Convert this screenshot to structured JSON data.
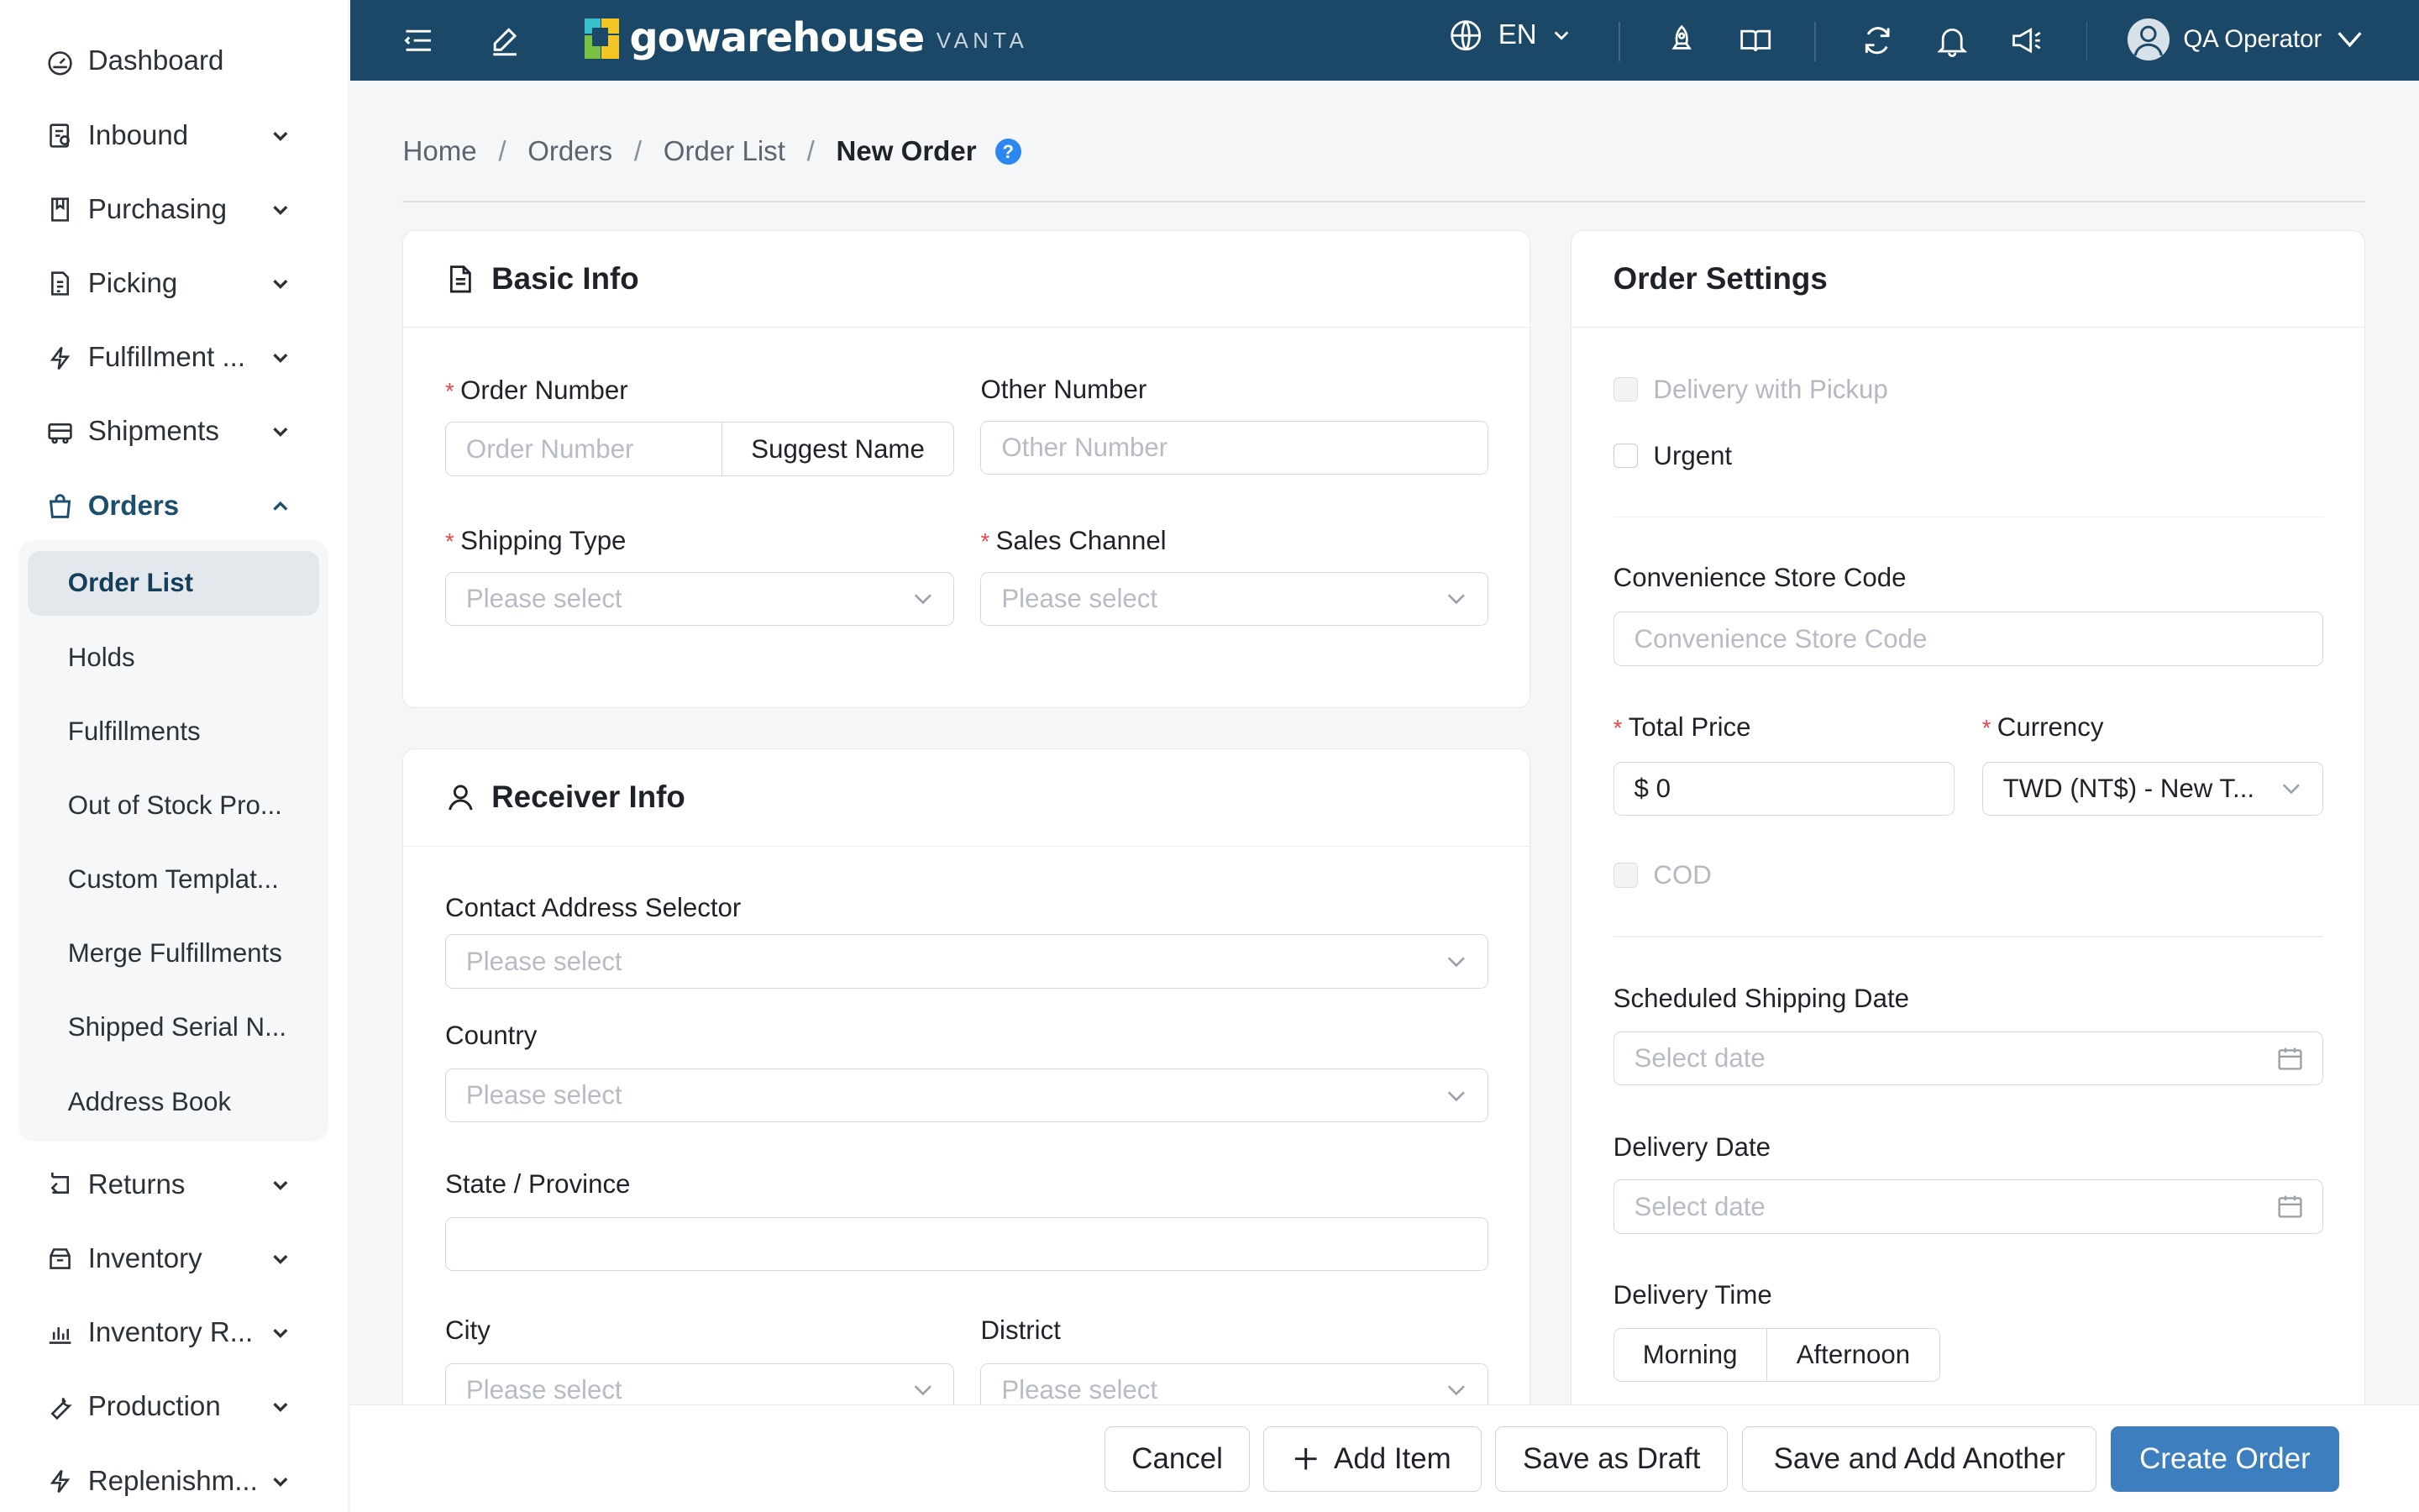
{
  "sidebar": {
    "items": [
      {
        "label": "Dashboard"
      },
      {
        "label": "Inbound"
      },
      {
        "label": "Purchasing"
      },
      {
        "label": "Picking"
      },
      {
        "label": "Fulfillment ..."
      },
      {
        "label": "Shipments"
      },
      {
        "label": "Orders"
      },
      {
        "label": "Returns"
      },
      {
        "label": "Inventory"
      },
      {
        "label": "Inventory R..."
      },
      {
        "label": "Production"
      },
      {
        "label": "Replenishm..."
      }
    ],
    "orders_submenu": [
      {
        "label": "Order List"
      },
      {
        "label": "Holds"
      },
      {
        "label": "Fulfillments"
      },
      {
        "label": "Out of Stock Pro..."
      },
      {
        "label": "Custom Templat..."
      },
      {
        "label": "Merge Fulfillments"
      },
      {
        "label": "Shipped Serial N..."
      },
      {
        "label": "Address Book"
      }
    ]
  },
  "topbar": {
    "brand_name": "gowarehouse",
    "brand_sub": "VANTA",
    "language": "EN",
    "user_name": "QA Operator"
  },
  "breadcrumb": {
    "items": [
      "Home",
      "Orders",
      "Order List",
      "New Order"
    ],
    "help": "?"
  },
  "basic_info": {
    "title": "Basic Info",
    "order_number_label": "Order Number",
    "order_number_placeholder": "Order Number",
    "suggest_name_label": "Suggest Name",
    "other_number_label": "Other Number",
    "other_number_placeholder": "Other Number",
    "shipping_type_label": "Shipping Type",
    "shipping_type_placeholder": "Please select",
    "sales_channel_label": "Sales Channel",
    "sales_channel_placeholder": "Please select"
  },
  "receiver_info": {
    "title": "Receiver Info",
    "contact_label": "Contact Address Selector",
    "contact_placeholder": "Please select",
    "country_label": "Country",
    "country_placeholder": "Please select",
    "state_label": "State / Province",
    "state_value": "",
    "city_label": "City",
    "city_placeholder": "Please select",
    "district_label": "District",
    "district_placeholder": "Please select"
  },
  "order_settings": {
    "title": "Order Settings",
    "delivery_with_pickup": "Delivery with Pickup",
    "urgent": "Urgent",
    "store_code_label": "Convenience Store Code",
    "store_code_placeholder": "Convenience Store Code",
    "total_price_label": "Total Price",
    "total_price_value": "$ 0",
    "currency_label": "Currency",
    "currency_value": "TWD (NT$) - New T...",
    "cod": "COD",
    "scheduled_date_label": "Scheduled Shipping Date",
    "scheduled_date_placeholder": "Select date",
    "delivery_date_label": "Delivery Date",
    "delivery_date_placeholder": "Select date",
    "delivery_time_label": "Delivery Time",
    "delivery_time_options": [
      "Morning",
      "Afternoon"
    ]
  },
  "footer": {
    "cancel": "Cancel",
    "add_item": "Add Item",
    "save_draft": "Save as Draft",
    "save_add_another": "Save and Add Another",
    "create_order": "Create Order"
  },
  "colors": {
    "topbar_bg": "#1a4866",
    "primary": "#3d7fbe",
    "required": "#e5484d",
    "help": "#2c88f0"
  }
}
